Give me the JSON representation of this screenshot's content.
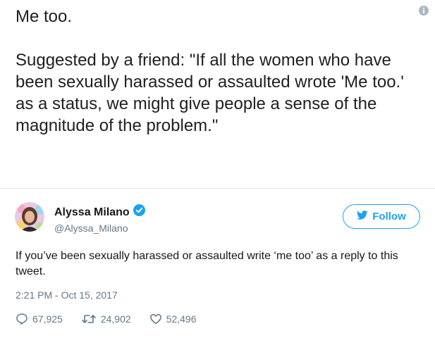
{
  "quote": {
    "line1": "Me too.",
    "paragraph": "Suggested by a friend: \"If all the women who have been sexually harassed or assaulted wrote 'Me too.' as a status, we might give people a sense of the magnitude of the problem.\""
  },
  "tweet": {
    "author_name": "Alyssa Milano",
    "handle": "@Alyssa_Milano",
    "follow_label": "Follow",
    "text": "If you’ve been sexually harassed or assaulted write ‘me too’ as a reply to this tweet.",
    "timestamp": "2:21 PM - Oct 15, 2017",
    "replies": "67,925",
    "retweets": "24,902",
    "likes": "52,496"
  },
  "colors": {
    "accent": "#1da1f2",
    "secondary_text": "#657786",
    "divider": "#e1e8ed"
  },
  "icons": [
    "info-icon",
    "verified-badge-icon",
    "twitter-bird-icon",
    "reply-icon",
    "retweet-icon",
    "like-icon"
  ]
}
